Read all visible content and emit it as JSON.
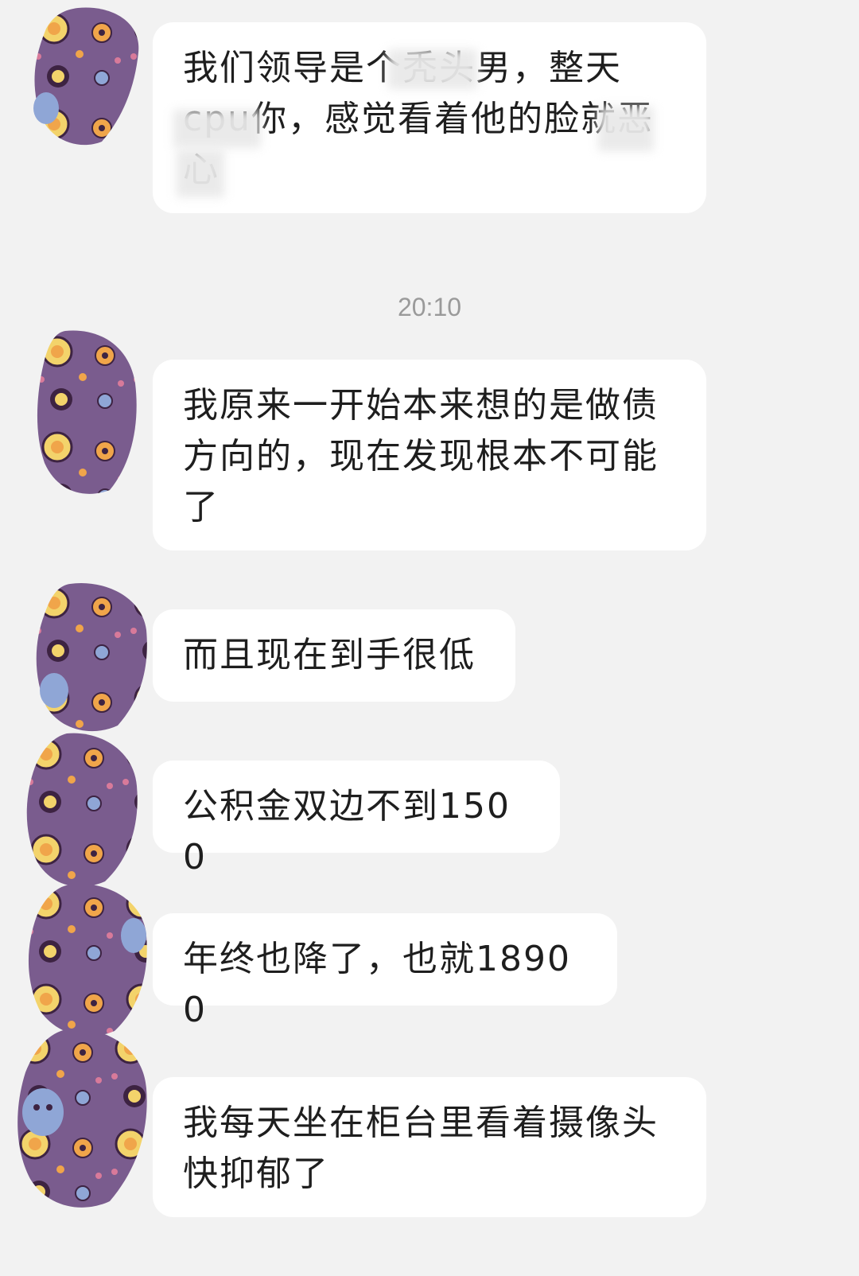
{
  "chat": {
    "timestamp": "20:10",
    "messages": [
      {
        "text": "我们领导是个秃头男，整天\ncpu你，感觉看着他的脸就恶\n心"
      },
      {
        "text": "我原来一开始本来想的是做债\n方向的，现在发现根本不可能\n了"
      },
      {
        "text": "而且现在到手很低"
      },
      {
        "text": "公积金双边不到1500"
      },
      {
        "text": "年终也降了，也就18900"
      },
      {
        "text": "我每天坐在柜台里看着摄像头\n快抑郁了"
      }
    ]
  },
  "colors": {
    "background": "#f2f2f2",
    "bubble": "#ffffff",
    "avatar_purple": "#7a5c8e",
    "avatar_accent_orange": "#f0a54a",
    "avatar_accent_yellow": "#f3d36b",
    "avatar_accent_blue": "#8fa6d6",
    "timestamp": "#9a9a9a"
  }
}
